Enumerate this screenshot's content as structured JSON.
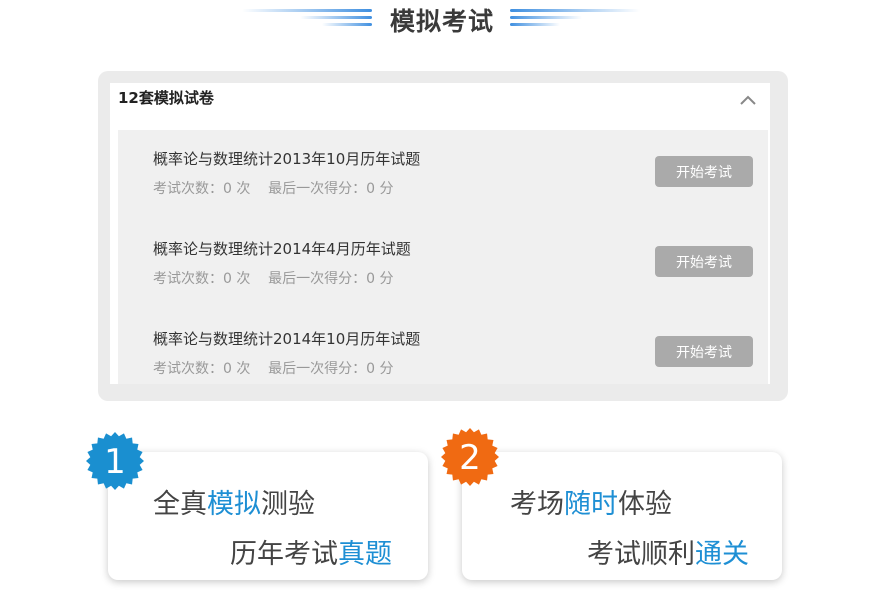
{
  "header": {
    "title": "模拟考试"
  },
  "panel": {
    "title": "12套模拟试卷",
    "items": [
      {
        "title": "概率论与数理统计2013年10月历年试题",
        "meta": "考试次数：0 次    最后一次得分：0 分",
        "button": "开始考试"
      },
      {
        "title": "概率论与数理统计2014年4月历年试题",
        "meta": "考试次数：0 次    最后一次得分：0 分",
        "button": "开始考试"
      },
      {
        "title": "概率论与数理统计2014年10月历年试题",
        "meta": "考试次数：0 次    最后一次得分：0 分",
        "button": "开始考试"
      }
    ]
  },
  "features": [
    {
      "number": "1",
      "badge_color": "#1a8fd0",
      "line1": {
        "a": "全真",
        "b": "模拟",
        "c": "测验"
      },
      "line2": {
        "a": "历年考试",
        "b": "真题"
      }
    },
    {
      "number": "2",
      "badge_color": "#f06a12",
      "line1": {
        "a": "考场",
        "b": "随时",
        "c": "体验"
      },
      "line2": {
        "a": "考试顺利",
        "b": "通关"
      }
    }
  ],
  "colors": {
    "accent": "#1e8fd4",
    "button_bg": "#aaaaaa",
    "panel_bg": "#ebebeb"
  }
}
